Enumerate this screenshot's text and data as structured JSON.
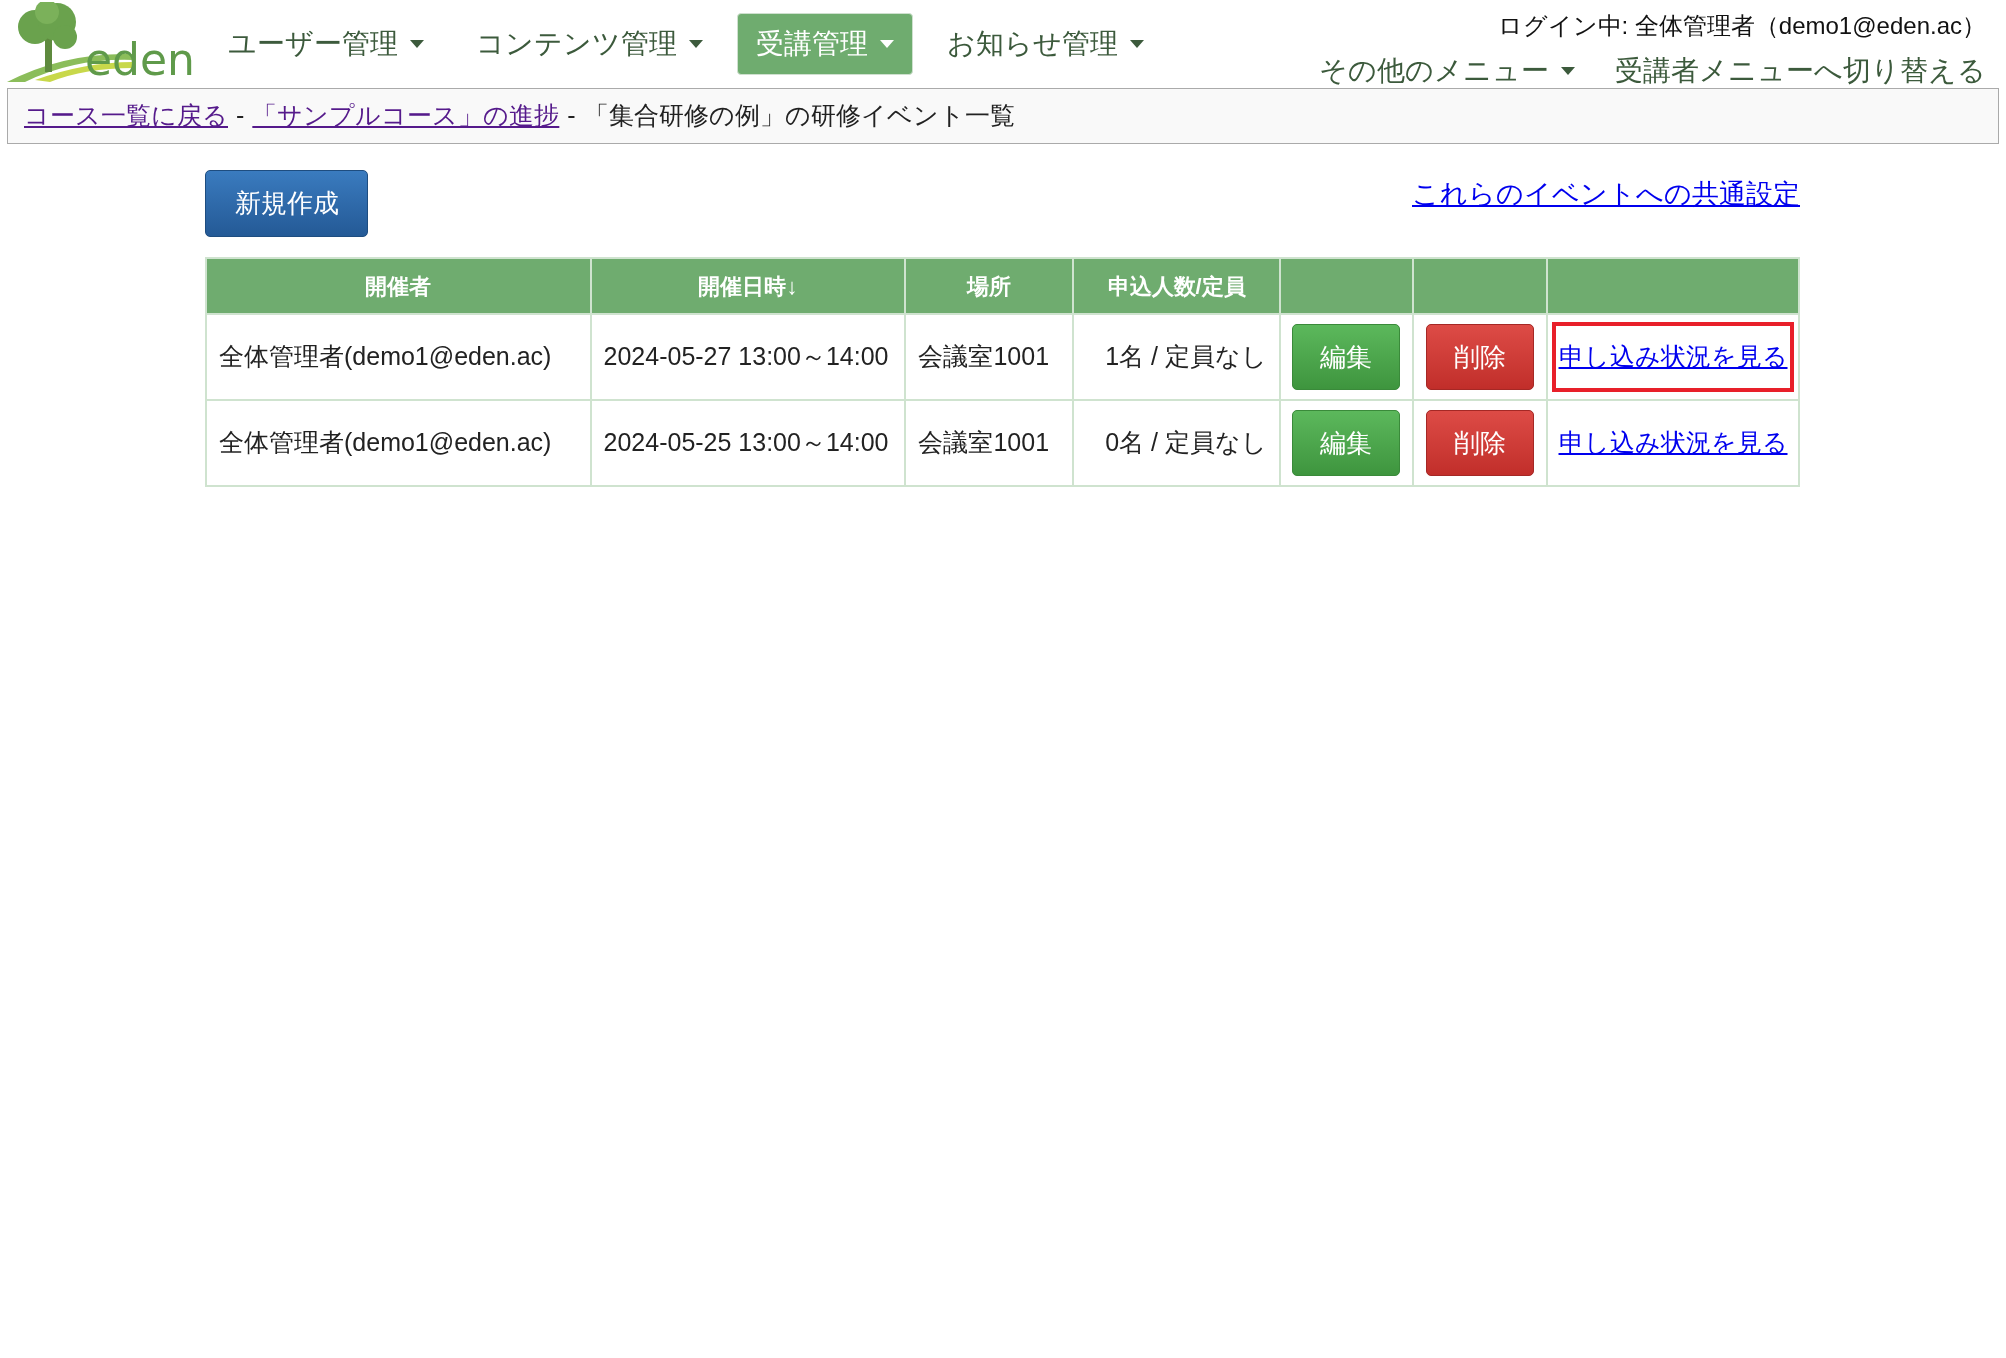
{
  "logo": {
    "text": "eden"
  },
  "nav": [
    {
      "label": "ユーザー管理",
      "selected": false
    },
    {
      "label": "コンテンツ管理",
      "selected": false
    },
    {
      "label": "受講管理",
      "selected": true
    },
    {
      "label": "お知らせ管理",
      "selected": false
    }
  ],
  "login": "ログイン中: 全体管理者（demo1@eden.ac）",
  "other_menu": "その他のメニュー",
  "switch_link": "受講者メニューへ切り替える",
  "breadcrumb": {
    "links": [
      "コース一覧に戻る",
      "「サンプルコース」の進捗"
    ],
    "separator": "-",
    "current": "「集合研修の例」の研修イベント一覧"
  },
  "new_button": "新規作成",
  "common_settings_link": "これらのイベントへの共通設定",
  "table": {
    "columns": [
      "開催者",
      "開催日時↓",
      "場所",
      "申込人数/定員"
    ],
    "rows": [
      {
        "organizer": "全体管理者(demo1@eden.ac)",
        "datetime": "2024-05-27 13:00～14:00",
        "place": "会議室1001",
        "count": "1名 / 定員なし",
        "edit": "編集",
        "delete": "削除",
        "status_link": "申し込み状況を見る",
        "highlighted": true
      },
      {
        "organizer": "全体管理者(demo1@eden.ac)",
        "datetime": "2024-05-25 13:00～14:00",
        "place": "会議室1001",
        "count": "0名 / 定員なし",
        "edit": "編集",
        "delete": "削除",
        "status_link": "申し込み状況を見る",
        "highlighted": false
      }
    ]
  }
}
